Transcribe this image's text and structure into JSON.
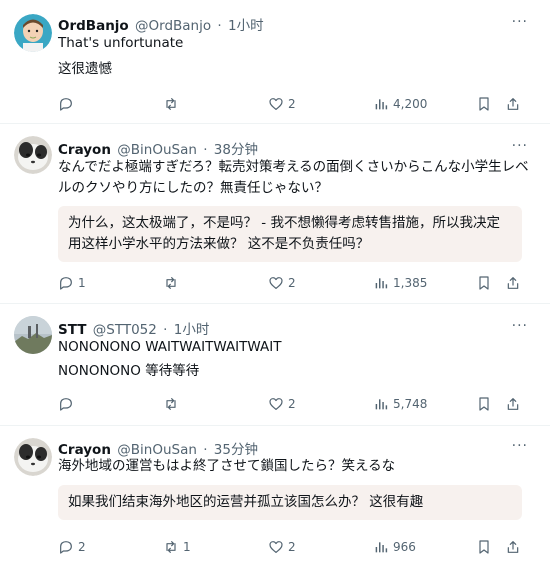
{
  "tweets": [
    {
      "name": "OrdBanjo",
      "handle": "@OrdBanjo",
      "time": "1小时",
      "text": "That's unfortunate",
      "translation": "这很遗憾",
      "replies": "",
      "reposts": "",
      "likes": "2",
      "views": "4,200"
    },
    {
      "name": "Crayon",
      "handle": "@BinOuSan",
      "time": "38分钟",
      "text": "なんでだよ極端すぎだろ？転売対策考えるの面倒くさいからこんな小学生レベルのクソやり方にしたの？無責任じゃない？",
      "translation": "为什么，这太极端了，不是吗？ - 我不想懒得考虑转售措施，所以我决定用这样小学水平的方法来做？ 这不是不负责任吗？",
      "replies": "1",
      "reposts": "",
      "likes": "2",
      "views": "1,385"
    },
    {
      "name": "STT",
      "handle": "@STT052",
      "time": "1小时",
      "text": "NONONONO WAITWAITWAITWAIT",
      "translation": "NONONONO 等待等待",
      "replies": "",
      "reposts": "",
      "likes": "2",
      "views": "5,748"
    },
    {
      "name": "Crayon",
      "handle": "@BinOuSan",
      "time": "35分钟",
      "text": "海外地域の運営もはよ終了させて鎖国したら？笑えるな",
      "translation": "如果我们结束海外地区的运营并孤立该国怎么办？ 这很有趣",
      "replies": "2",
      "reposts": "1",
      "likes": "2",
      "views": "966"
    }
  ],
  "dot": "·",
  "more_label": "···",
  "icons": {
    "reply": "reply-icon",
    "repost": "repost-icon",
    "like": "heart-icon",
    "views": "views-icon",
    "bookmark": "bookmark-icon",
    "share": "share-icon"
  },
  "colors": {
    "muted": "#536471",
    "translation_bg": "#f7f1ee",
    "divider": "#eff3f4"
  }
}
